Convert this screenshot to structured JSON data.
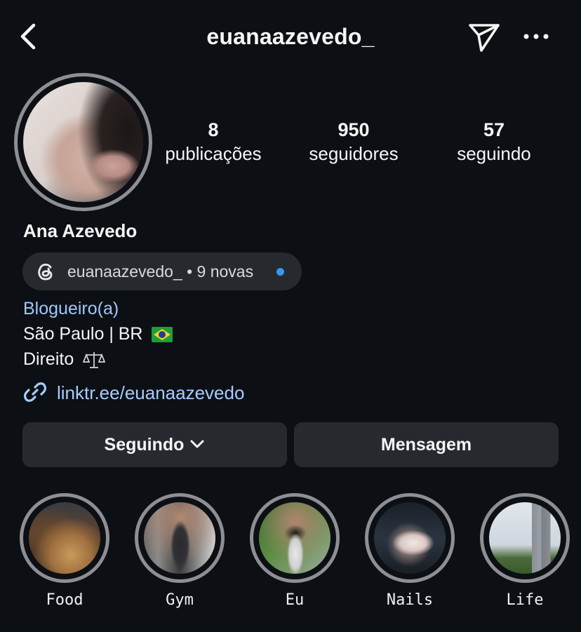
{
  "header": {
    "username": "euanaazevedo_"
  },
  "profile": {
    "stats": [
      {
        "value": "8",
        "label": "publicações"
      },
      {
        "value": "950",
        "label": "seguidores"
      },
      {
        "value": "57",
        "label": "seguindo"
      }
    ],
    "display_name": "Ana Azevedo",
    "threads_badge": "euanaazevedo_ • 9 novas",
    "category": "Blogueiro(a)",
    "bio_line_1": "São Paulo | BR",
    "bio_line_2": "Direito",
    "link": "linktr.ee/euanaazevedo"
  },
  "actions": {
    "following_label": "Seguindo",
    "message_label": "Mensagem"
  },
  "highlights": [
    {
      "label": "Food"
    },
    {
      "label": "Gym"
    },
    {
      "label": "Eu"
    },
    {
      "label": "Nails"
    },
    {
      "label": "Life"
    }
  ],
  "icons": [
    "chevron-left-icon",
    "send-icon",
    "more-icon",
    "threads-icon",
    "link-icon",
    "chevron-down-icon",
    "brazil-flag-icon",
    "scales-icon"
  ],
  "colors": {
    "background": "#0c1014",
    "button": "#262a2f",
    "link": "#a8cbff",
    "category": "#9fc7ff",
    "notification_dot": "#3897f0"
  }
}
